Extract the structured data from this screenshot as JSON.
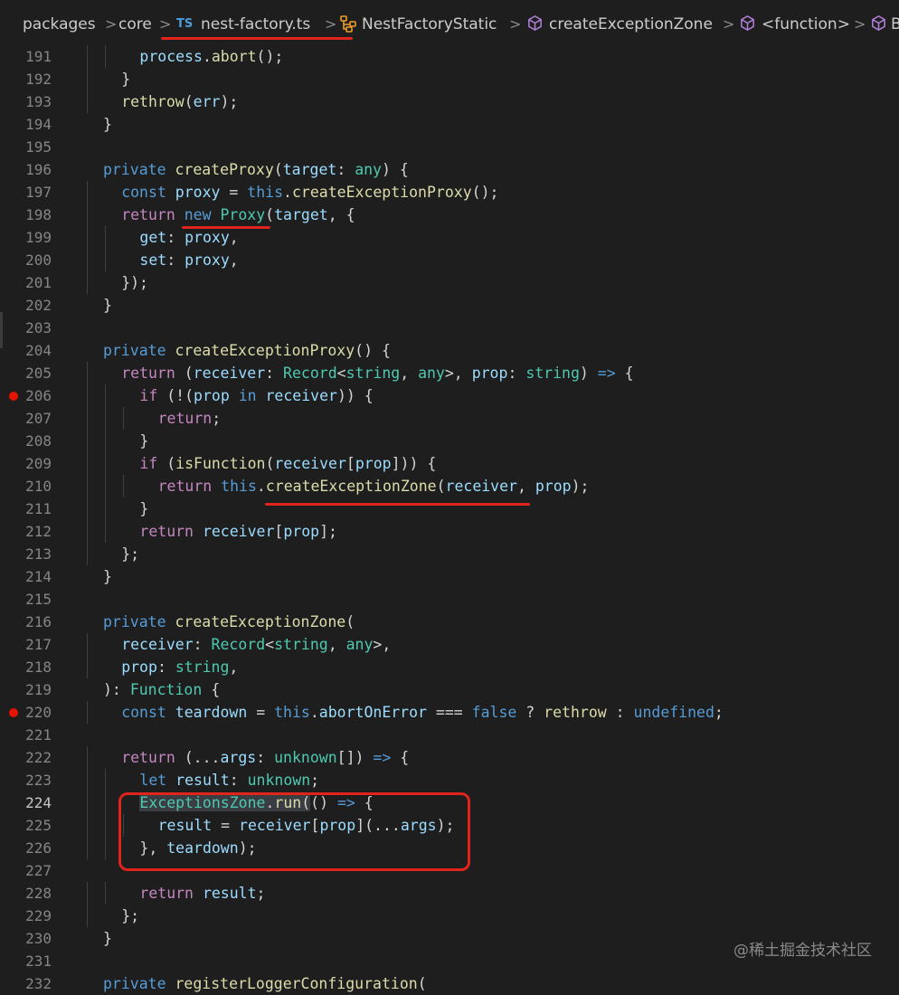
{
  "breadcrumb": {
    "items": [
      "packages",
      "core",
      "nest-factory.ts",
      "NestFactoryStatic",
      "createExceptionZone",
      "<function>",
      "B"
    ],
    "ts_badge": "TS",
    "separator": ">"
  },
  "editor": {
    "active_line": 224,
    "breakpoint_lines": [
      206,
      220
    ],
    "lines": [
      {
        "n": 191,
        "i": 2,
        "t": [
          [
            "process",
            "v"
          ],
          [
            ".",
            "p"
          ],
          [
            "abort",
            "f"
          ],
          [
            "();",
            "p"
          ]
        ]
      },
      {
        "n": 192,
        "i": 1,
        "t": [
          [
            "}",
            "p"
          ]
        ]
      },
      {
        "n": 193,
        "i": 1,
        "t": [
          [
            "rethrow",
            "f"
          ],
          [
            "(",
            "p"
          ],
          [
            "err",
            "v"
          ],
          [
            ");",
            "p"
          ]
        ]
      },
      {
        "n": 194,
        "i": 0,
        "t": [
          [
            "}",
            "p"
          ]
        ]
      },
      {
        "n": 195,
        "i": 0,
        "t": []
      },
      {
        "n": 196,
        "i": 0,
        "t": [
          [
            "private ",
            "k"
          ],
          [
            "createProxy",
            "f"
          ],
          [
            "(",
            "p"
          ],
          [
            "target",
            "v"
          ],
          [
            ": ",
            "p"
          ],
          [
            "any",
            "t"
          ],
          [
            ") {",
            "p"
          ]
        ]
      },
      {
        "n": 197,
        "i": 1,
        "t": [
          [
            "const ",
            "k"
          ],
          [
            "proxy",
            "v"
          ],
          [
            " = ",
            "p"
          ],
          [
            "this",
            "k"
          ],
          [
            ".",
            "p"
          ],
          [
            "createExceptionProxy",
            "f"
          ],
          [
            "();",
            "p"
          ]
        ]
      },
      {
        "n": 198,
        "i": 1,
        "t": [
          [
            "return ",
            "c"
          ],
          [
            "new ",
            "k"
          ],
          [
            "Proxy",
            "t"
          ],
          [
            "(",
            "p"
          ],
          [
            "target",
            "v"
          ],
          [
            ", {",
            "p"
          ]
        ]
      },
      {
        "n": 199,
        "i": 2,
        "t": [
          [
            "get",
            "v"
          ],
          [
            ": ",
            "p"
          ],
          [
            "proxy",
            "v"
          ],
          [
            ",",
            "p"
          ]
        ]
      },
      {
        "n": 200,
        "i": 2,
        "t": [
          [
            "set",
            "v"
          ],
          [
            ": ",
            "p"
          ],
          [
            "proxy",
            "v"
          ],
          [
            ",",
            "p"
          ]
        ]
      },
      {
        "n": 201,
        "i": 1,
        "t": [
          [
            "});",
            "p"
          ]
        ]
      },
      {
        "n": 202,
        "i": 0,
        "t": [
          [
            "}",
            "p"
          ]
        ]
      },
      {
        "n": 203,
        "i": 0,
        "t": []
      },
      {
        "n": 204,
        "i": 0,
        "t": [
          [
            "private ",
            "k"
          ],
          [
            "createExceptionProxy",
            "f"
          ],
          [
            "() {",
            "p"
          ]
        ]
      },
      {
        "n": 205,
        "i": 1,
        "t": [
          [
            "return ",
            "c"
          ],
          [
            "(",
            "p"
          ],
          [
            "receiver",
            "v"
          ],
          [
            ": ",
            "p"
          ],
          [
            "Record",
            "t"
          ],
          [
            "<",
            "p"
          ],
          [
            "string",
            "t"
          ],
          [
            ", ",
            "p"
          ],
          [
            "any",
            "t"
          ],
          [
            ">, ",
            "p"
          ],
          [
            "prop",
            "v"
          ],
          [
            ": ",
            "p"
          ],
          [
            "string",
            "t"
          ],
          [
            ") ",
            "p"
          ],
          [
            "=>",
            "k"
          ],
          [
            " {",
            "p"
          ]
        ]
      },
      {
        "n": 206,
        "i": 2,
        "t": [
          [
            "if ",
            "c"
          ],
          [
            "(!(",
            "p"
          ],
          [
            "prop ",
            "v"
          ],
          [
            "in ",
            "k"
          ],
          [
            "receiver",
            "v"
          ],
          [
            ")) {",
            "p"
          ]
        ]
      },
      {
        "n": 207,
        "i": 3,
        "t": [
          [
            "return",
            "c"
          ],
          [
            ";",
            "p"
          ]
        ]
      },
      {
        "n": 208,
        "i": 2,
        "t": [
          [
            "}",
            "p"
          ]
        ]
      },
      {
        "n": 209,
        "i": 2,
        "t": [
          [
            "if ",
            "c"
          ],
          [
            "(",
            "p"
          ],
          [
            "isFunction",
            "f"
          ],
          [
            "(",
            "p"
          ],
          [
            "receiver",
            "v"
          ],
          [
            "[",
            "p"
          ],
          [
            "prop",
            "v"
          ],
          [
            "])) {",
            "p"
          ]
        ]
      },
      {
        "n": 210,
        "i": 3,
        "t": [
          [
            "return ",
            "c"
          ],
          [
            "this",
            "k"
          ],
          [
            ".",
            "p"
          ],
          [
            "createExceptionZone",
            "f"
          ],
          [
            "(",
            "p"
          ],
          [
            "receiver",
            "v"
          ],
          [
            ", ",
            "p"
          ],
          [
            "prop",
            "v"
          ],
          [
            ");",
            "p"
          ]
        ]
      },
      {
        "n": 211,
        "i": 2,
        "t": [
          [
            "}",
            "p"
          ]
        ]
      },
      {
        "n": 212,
        "i": 2,
        "t": [
          [
            "return ",
            "c"
          ],
          [
            "receiver",
            "v"
          ],
          [
            "[",
            "p"
          ],
          [
            "prop",
            "v"
          ],
          [
            "];",
            "p"
          ]
        ]
      },
      {
        "n": 213,
        "i": 1,
        "t": [
          [
            "};",
            "p"
          ]
        ]
      },
      {
        "n": 214,
        "i": 0,
        "t": [
          [
            "}",
            "p"
          ]
        ]
      },
      {
        "n": 215,
        "i": 0,
        "t": []
      },
      {
        "n": 216,
        "i": 0,
        "t": [
          [
            "private ",
            "k"
          ],
          [
            "createExceptionZone",
            "f"
          ],
          [
            "(",
            "p"
          ]
        ]
      },
      {
        "n": 217,
        "i": 1,
        "t": [
          [
            "receiver",
            "v"
          ],
          [
            ": ",
            "p"
          ],
          [
            "Record",
            "t"
          ],
          [
            "<",
            "p"
          ],
          [
            "string",
            "t"
          ],
          [
            ", ",
            "p"
          ],
          [
            "any",
            "t"
          ],
          [
            ">,",
            "p"
          ]
        ]
      },
      {
        "n": 218,
        "i": 1,
        "t": [
          [
            "prop",
            "v"
          ],
          [
            ": ",
            "p"
          ],
          [
            "string",
            "t"
          ],
          [
            ",",
            "p"
          ]
        ]
      },
      {
        "n": 219,
        "i": 0,
        "t": [
          [
            "): ",
            "p"
          ],
          [
            "Function",
            "t"
          ],
          [
            " {",
            "p"
          ]
        ]
      },
      {
        "n": 220,
        "i": 1,
        "t": [
          [
            "const ",
            "k"
          ],
          [
            "teardown",
            "v"
          ],
          [
            " = ",
            "p"
          ],
          [
            "this",
            "k"
          ],
          [
            ".",
            "p"
          ],
          [
            "abortOnError",
            "v"
          ],
          [
            " === ",
            "p"
          ],
          [
            "false",
            "k"
          ],
          [
            " ? ",
            "p"
          ],
          [
            "rethrow",
            "f"
          ],
          [
            " : ",
            "p"
          ],
          [
            "undefined",
            "k"
          ],
          [
            ";",
            "p"
          ]
        ]
      },
      {
        "n": 221,
        "i": 0,
        "t": []
      },
      {
        "n": 222,
        "i": 1,
        "t": [
          [
            "return ",
            "c"
          ],
          [
            "(...",
            "p"
          ],
          [
            "args",
            "v"
          ],
          [
            ": ",
            "p"
          ],
          [
            "unknown",
            "t"
          ],
          [
            "[]) ",
            "p"
          ],
          [
            "=>",
            "k"
          ],
          [
            " {",
            "p"
          ]
        ]
      },
      {
        "n": 223,
        "i": 2,
        "t": [
          [
            "let ",
            "k"
          ],
          [
            "result",
            "v"
          ],
          [
            ": ",
            "p"
          ],
          [
            "unknown",
            "t"
          ],
          [
            ";",
            "p"
          ]
        ]
      },
      {
        "n": 224,
        "i": 2,
        "t": [
          [
            "ExceptionsZone",
            "t",
            "hl"
          ],
          [
            ".",
            "p",
            "hl"
          ],
          [
            "run",
            "f",
            "hl"
          ],
          [
            "(",
            "p",
            "hl"
          ],
          [
            "() ",
            "p"
          ],
          [
            "=>",
            "k"
          ],
          [
            " {",
            "p"
          ]
        ]
      },
      {
        "n": 225,
        "i": 3,
        "t": [
          [
            "result",
            "v"
          ],
          [
            " = ",
            "p"
          ],
          [
            "receiver",
            "v"
          ],
          [
            "[",
            "p"
          ],
          [
            "prop",
            "v"
          ],
          [
            "](...",
            "p"
          ],
          [
            "args",
            "v"
          ],
          [
            ");",
            "p"
          ]
        ]
      },
      {
        "n": 226,
        "i": 2,
        "t": [
          [
            "}, ",
            "p"
          ],
          [
            "teardown",
            "v"
          ],
          [
            ");",
            "p"
          ]
        ]
      },
      {
        "n": 227,
        "i": 0,
        "t": []
      },
      {
        "n": 228,
        "i": 2,
        "t": [
          [
            "return ",
            "c"
          ],
          [
            "result",
            "v"
          ],
          [
            ";",
            "p"
          ]
        ]
      },
      {
        "n": 229,
        "i": 1,
        "t": [
          [
            "};",
            "p"
          ]
        ]
      },
      {
        "n": 230,
        "i": 0,
        "t": [
          [
            "}",
            "p"
          ]
        ]
      },
      {
        "n": 231,
        "i": 0,
        "t": []
      },
      {
        "n": 232,
        "i": 0,
        "t": [
          [
            "private ",
            "k"
          ],
          [
            "registerLoggerConfiguration",
            "f"
          ],
          [
            "(",
            "p"
          ]
        ]
      }
    ]
  },
  "colors": {
    "background": "#1e1e1e",
    "annotation": "#e0241c",
    "breakpoint": "#e51400",
    "keyword": "#569cd6",
    "control": "#c586c0",
    "function": "#dcdcaa",
    "variable": "#9cdcfe",
    "type": "#4ec9b0"
  },
  "icons": {
    "file": "typescript-file-icon",
    "class": "class-icon",
    "method": "cube-method-icon",
    "function": "cube-function-icon"
  },
  "watermark": "@稀土掘金技术社区"
}
